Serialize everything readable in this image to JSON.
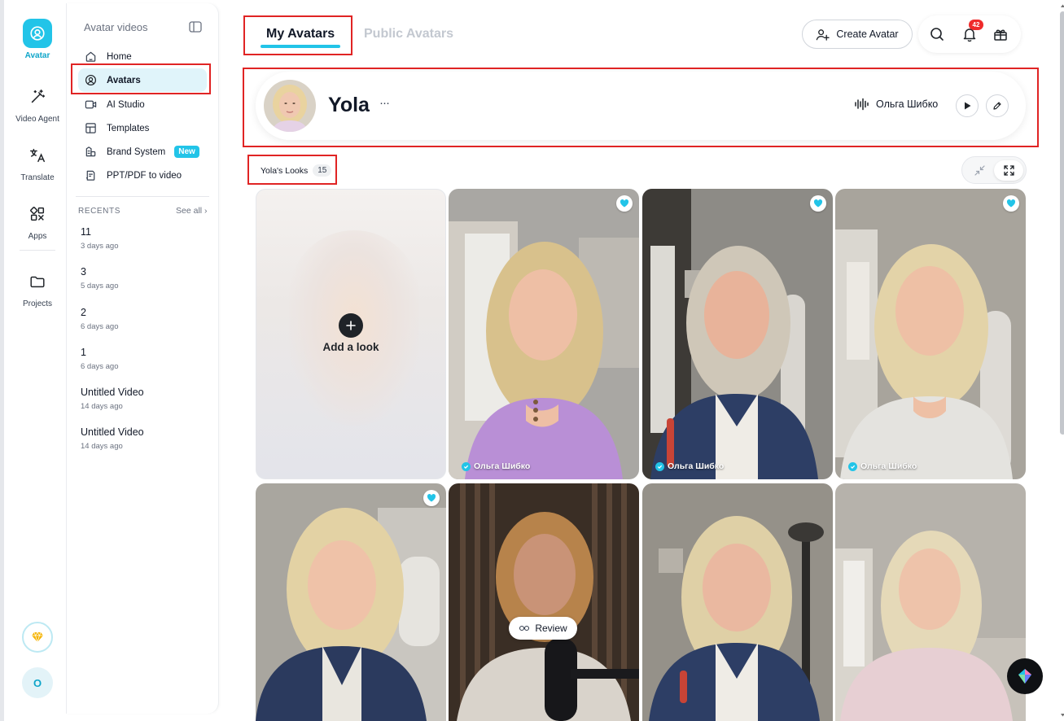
{
  "rail": {
    "items": [
      {
        "label": "Avatar",
        "icon": "avatar-icon"
      },
      {
        "label": "Video Agent",
        "icon": "magic-wand-icon"
      },
      {
        "label": "Translate",
        "icon": "translate-icon"
      },
      {
        "label": "Apps",
        "icon": "apps-icon"
      },
      {
        "label": "Projects",
        "icon": "folder-icon"
      }
    ],
    "upgrade_icon": "diamond-icon",
    "profile_initial": "O"
  },
  "sidebar": {
    "title": "Avatar videos",
    "nav": [
      {
        "label": "Home",
        "icon": "home-icon"
      },
      {
        "label": "Avatars",
        "icon": "avatar-circle-icon"
      },
      {
        "label": "AI Studio",
        "icon": "video-camera-icon"
      },
      {
        "label": "Templates",
        "icon": "templates-icon"
      },
      {
        "label": "Brand System",
        "icon": "brand-icon",
        "badge": "New"
      },
      {
        "label": "PPT/PDF to video",
        "icon": "ppt-icon"
      }
    ],
    "recents_heading": "RECENTS",
    "see_all": "See all ›",
    "recents": [
      {
        "name": "11",
        "date": "3 days ago"
      },
      {
        "name": "3",
        "date": "5 days ago"
      },
      {
        "name": "2",
        "date": "6 days ago"
      },
      {
        "name": "1",
        "date": "6 days ago"
      },
      {
        "name": "Untitled Video",
        "date": "14 days ago"
      },
      {
        "name": "Untitled Video",
        "date": "14 days ago"
      }
    ]
  },
  "header": {
    "tabs": [
      {
        "label": "My Avatars",
        "active": true
      },
      {
        "label": "Public Avatars",
        "active": false
      }
    ],
    "create_button": "Create Avatar",
    "notifications_count": "42"
  },
  "avatar": {
    "name": "Yola",
    "more": "···",
    "voice_name": "Ольга Шибко"
  },
  "looks": {
    "label": "Yola's Looks",
    "count": "15",
    "add_label": "Add a look",
    "review_label": "Review",
    "owner": "Ольга Шибко"
  },
  "colors": {
    "accent": "#22c4e8",
    "highlight": "#e02424",
    "badge_red": "#ef2b2b"
  }
}
